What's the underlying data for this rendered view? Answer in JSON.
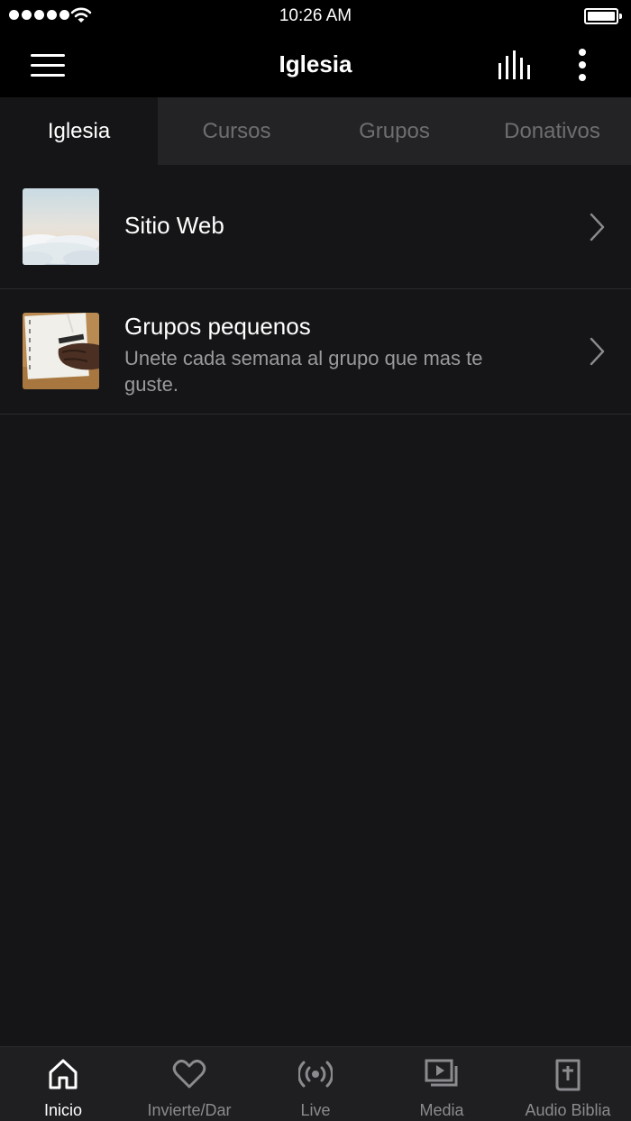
{
  "status_bar": {
    "time": "10:26 AM",
    "signal_icon": "signal-dots-icon",
    "wifi_icon": "wifi-icon",
    "battery_icon": "battery-icon"
  },
  "nav": {
    "title": "Iglesia",
    "menu_icon": "hamburger-menu-icon",
    "equalizer_icon": "equalizer-icon",
    "more_icon": "more-vertical-icon"
  },
  "tabs": [
    {
      "label": "Iglesia",
      "active": true
    },
    {
      "label": "Cursos",
      "active": false
    },
    {
      "label": "Grupos",
      "active": false
    },
    {
      "label": "Donativos",
      "active": false
    }
  ],
  "list": [
    {
      "title": "Sitio Web",
      "subtitle": "",
      "thumbnail": "clouds-photo",
      "chevron_icon": "chevron-right-icon"
    },
    {
      "title": "Grupos pequenos",
      "subtitle": "Unete cada semana al grupo que mas te guste.",
      "thumbnail": "notebook-writing-photo",
      "chevron_icon": "chevron-right-icon"
    }
  ],
  "tabbar": [
    {
      "label": "Inicio",
      "icon": "home-icon",
      "active": true
    },
    {
      "label": "Invierte/Dar",
      "icon": "heart-icon",
      "active": false
    },
    {
      "label": "Live",
      "icon": "broadcast-icon",
      "active": false
    },
    {
      "label": "Media",
      "icon": "media-play-icon",
      "active": false
    },
    {
      "label": "Audio Biblia",
      "icon": "bible-icon",
      "active": false
    }
  ],
  "colors": {
    "background": "#151517",
    "bar": "#000000",
    "tabs_bg": "#232325",
    "inactive_text": "#6e6e72"
  }
}
